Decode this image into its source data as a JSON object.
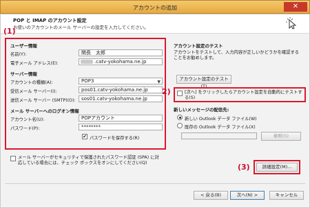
{
  "window": {
    "title": "アカウントの追加",
    "close_glyph": "✕"
  },
  "header": {
    "title": "POP と IMAP のアカウント設定",
    "subtitle": "お使いのアカウントのメール サーバーの設定を入力してください。"
  },
  "annotations": {
    "one": "(1)",
    "two": "2)",
    "three": "(3)"
  },
  "user_info": {
    "heading": "ユーザー情報",
    "name_label": "名前(Y):",
    "name_value": "関長　太郎",
    "email_label": "電子メール アドレス(E):",
    "email_value": ".catv-yokohama.ne.jp"
  },
  "server_info": {
    "heading": "サーバー情報",
    "type_label": "アカウントの種類(A):",
    "type_value": "POP3",
    "incoming_label": "受信メール サーバー(I):",
    "incoming_value": "pos01.catv-yokohama.ne.jp",
    "outgoing_label": "送信メール サーバー (SMTP)(O):",
    "outgoing_value": "sos01.catv-yokohama.ne.jp"
  },
  "logon_info": {
    "heading": "メール サーバーへのログオン情報",
    "account_label": "アカウント名(U):",
    "account_value": "POPアカウント",
    "password_label": "パスワード(P):",
    "password_value": "********",
    "remember_label": "パスワードを保存する(R)",
    "remember_checked": "✔"
  },
  "spa": {
    "label": "メール サーバーがセキュリティで保護されたパスワード認証 (SPA) に対応している場合には、チェック ボックスをオンにしてください(Q)"
  },
  "test": {
    "heading": "アカウント設定のテスト",
    "description": "アカウントをテストして、入力内容が正しいかどうかを確認することをお勧めします。",
    "button": "アカウント設定のテスト(T)",
    "auto_test_label": "[次へ] をクリックしたらアカウント設定を自動的にテストする(S)"
  },
  "delivery": {
    "heading": "新しいメッセージの配信先:",
    "new_file": "新しい Outlook データ ファイル(W)",
    "existing_file": "既存の Outlook データ ファイル(X)",
    "browse": "参照(S)"
  },
  "buttons": {
    "more": "詳細設定(M)...",
    "back": "< 戻る(B)",
    "next": "次へ(N) >",
    "cancel": "キャンセル"
  }
}
